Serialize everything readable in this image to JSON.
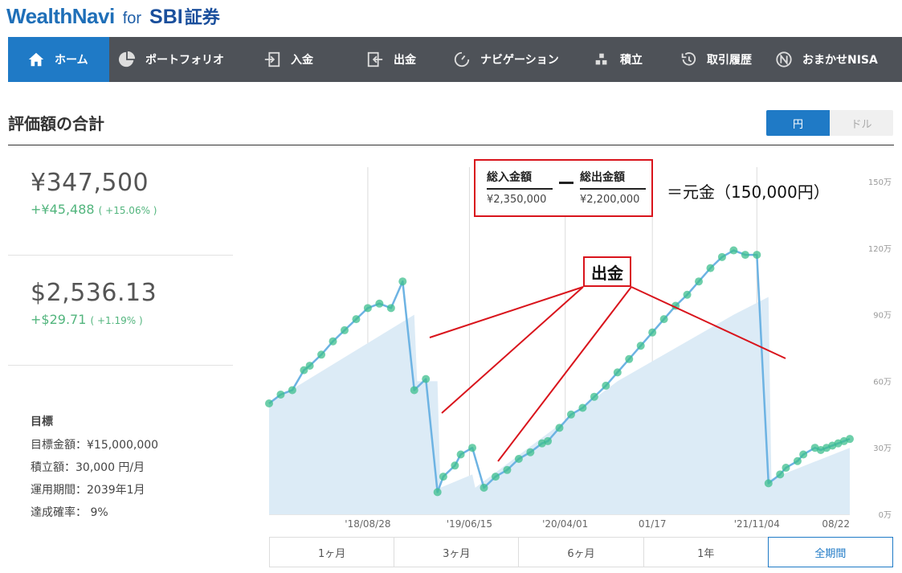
{
  "brand": {
    "name": "WealthNavi",
    "for": "for",
    "partner_latin": "SBI",
    "partner_jp": "証券"
  },
  "nav": [
    {
      "label": "ホーム",
      "icon": "home-icon",
      "active": true
    },
    {
      "label": "ポートフォリオ",
      "icon": "pie-chart-icon",
      "active": false
    },
    {
      "label": "入金",
      "icon": "deposit-icon",
      "active": false
    },
    {
      "label": "出金",
      "icon": "withdraw-icon",
      "active": false
    },
    {
      "label": "ナビゲーション",
      "icon": "navigation-icon",
      "active": false
    },
    {
      "label": "積立",
      "icon": "blocks-icon",
      "active": false
    },
    {
      "label": "取引履歴",
      "icon": "history-icon",
      "active": false
    },
    {
      "label": "おまかせNISA",
      "icon": "nisa-icon",
      "active": false
    }
  ],
  "page": {
    "title": "評価額の合計"
  },
  "currency_toggle": {
    "jpy": "円",
    "usd": "ドル",
    "selected": "jpy"
  },
  "summary": {
    "jpy": {
      "amount": "¥347,500",
      "gain": "+¥45,488",
      "pct": "( +15.06% )"
    },
    "usd": {
      "amount": "$2,536.13",
      "gain": "+$29.71",
      "pct": "( +1.19% )"
    }
  },
  "goal": {
    "title": "目標",
    "target_amount": "目標金額：¥15,000,000",
    "monthly": "積立額：30,000 円/月",
    "period": "運用期間：2039年1月",
    "probability": "達成確率： 9%"
  },
  "annotations": {
    "total_in_label": "総入金額",
    "total_in_value": "¥2,350,000",
    "total_out_label": "総出金額",
    "total_out_value": "¥2,200,000",
    "equals_text": "＝元金（150,000円）",
    "withdraw_label": "出金",
    "line_color": "#d9141c"
  },
  "range_buttons": [
    {
      "label": "1ヶ月",
      "active": false
    },
    {
      "label": "3ヶ月",
      "active": false
    },
    {
      "label": "6ヶ月",
      "active": false
    },
    {
      "label": "1年",
      "active": false
    },
    {
      "label": "全期間",
      "active": true
    }
  ],
  "colors": {
    "accent": "#1f7ac6",
    "nav_bg": "#4e5258",
    "gain": "#52b57d",
    "line": "#6db3e3",
    "area": "#dcebf6",
    "marker": "#3dbf8e"
  },
  "chart_data": {
    "type": "line",
    "x_tick_labels": [
      "'18/08/28",
      "'19/06/15",
      "'20/04/01",
      "01/17",
      "'21/11/04",
      "08/22"
    ],
    "y_tick_labels": [
      "0万",
      "30万",
      "60万",
      "90万",
      "120万",
      "150万"
    ],
    "ylim": [
      0,
      150
    ],
    "x_range": [
      0,
      100
    ],
    "grid": true,
    "series": [
      {
        "kind": "valuation",
        "x": [
          0,
          2,
          4,
          6,
          7,
          9,
          11,
          13,
          15,
          17,
          19,
          21,
          23,
          25,
          27,
          29,
          30,
          32,
          33,
          35,
          37,
          39,
          41,
          43,
          45,
          47,
          48,
          50,
          52,
          54,
          56,
          58,
          60,
          62,
          64,
          66,
          68,
          70,
          72,
          74,
          76,
          78,
          80,
          82,
          84,
          86,
          88,
          89,
          91,
          92,
          94,
          95,
          96,
          97,
          98,
          99,
          100
        ],
        "values": [
          50,
          54,
          56,
          65,
          67,
          72,
          78,
          83,
          88,
          93,
          95,
          93,
          105,
          56,
          61,
          10,
          17,
          22,
          27,
          30,
          12,
          17,
          20,
          25,
          28,
          32,
          33,
          39,
          45,
          48,
          53,
          58,
          64,
          70,
          76,
          82,
          88,
          94,
          99,
          105,
          111,
          116,
          119,
          117,
          117,
          14,
          18,
          21,
          24,
          27,
          30,
          29,
          30,
          31,
          32,
          33,
          34
        ]
      },
      {
        "kind": "principal",
        "x": [
          0,
          25,
          25.5,
          29,
          29.5,
          35,
          35.5,
          60,
          80,
          86,
          86.5,
          100
        ],
        "values": [
          50,
          90,
          60,
          60,
          12,
          18,
          12,
          60,
          90,
          98,
          16,
          30
        ]
      }
    ]
  }
}
